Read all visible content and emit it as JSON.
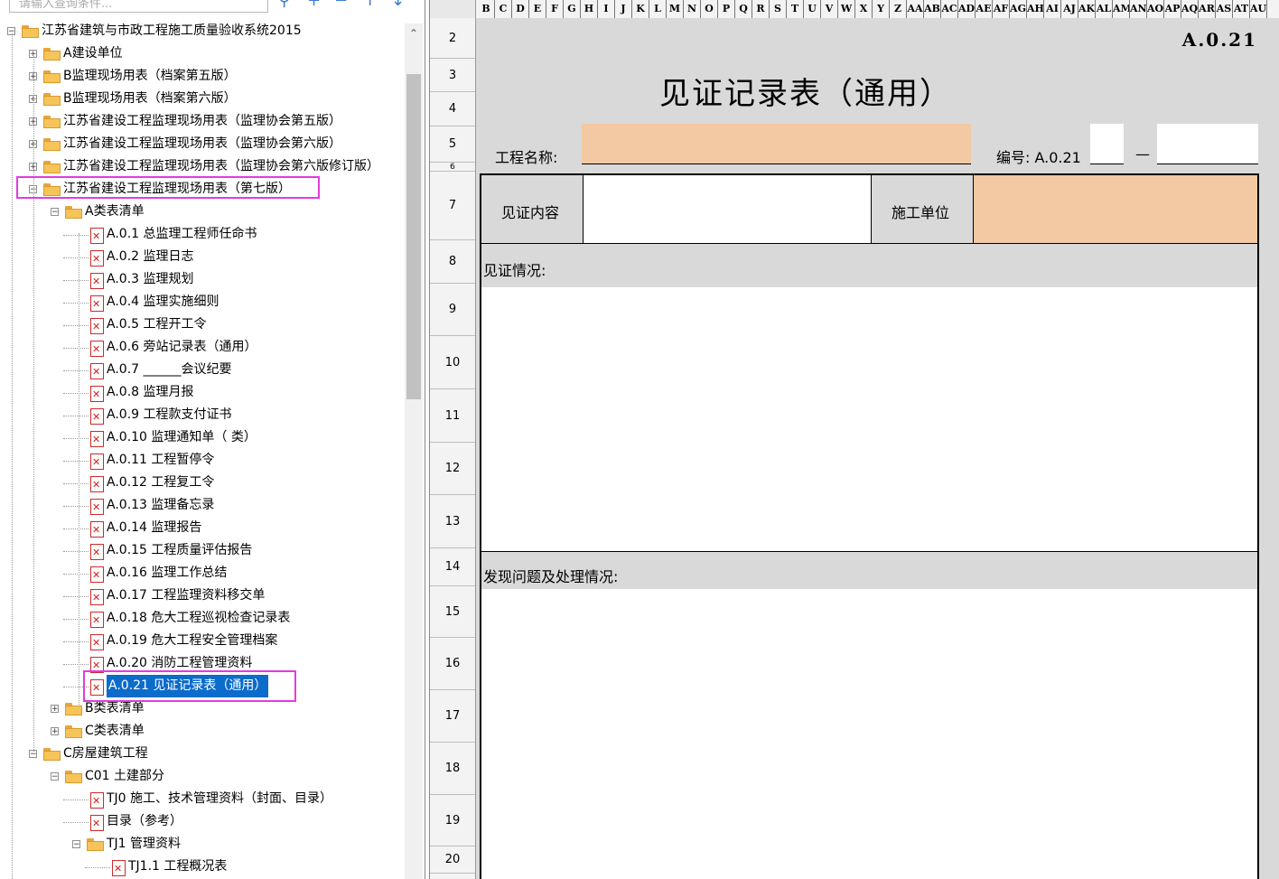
{
  "search": {
    "placeholder": "请输入查询条件..."
  },
  "toolbar": {
    "search_icon": "search-icon",
    "add_icon": "plus-icon",
    "remove_icon": "minus-icon",
    "up_icon": "arrow-up-icon",
    "down_icon": "arrow-down-icon"
  },
  "tree": {
    "root": "江苏省建筑与市政工程施工质量验收系统2015",
    "nodes": [
      "A建设单位",
      "B监理现场用表（档案第五版）",
      "B监理现场用表（档案第六版）",
      "江苏省建设工程监理现场用表（监理协会第五版）",
      "江苏省建设工程监理现场用表（监理协会第六版）",
      "江苏省建设工程监理现场用表（监理协会第六版修订版）",
      "江苏省建设工程监理现场用表（第七版）"
    ],
    "a_list": "A类表清单",
    "a_items": [
      "A.0.1  总监理工程师任命书",
      "A.0.2  监理日志",
      "A.0.3  监理规划",
      "A.0.4  监理实施细则",
      "A.0.5  工程开工令",
      "A.0.6  旁站记录表（通用）",
      "A.0.7  ______会议纪要",
      "A.0.8  监理月报",
      "A.0.9  工程款支付证书",
      "A.0.10  监理通知单（  类）",
      "A.0.11  工程暂停令",
      "A.0.12  工程复工令",
      "A.0.13  监理备忘录",
      "A.0.14  监理报告",
      "A.0.15  工程质量评估报告",
      "A.0.16  监理工作总结",
      "A.0.17  工程监理资料移交单",
      "A.0.18  危大工程巡视检查记录表",
      "A.0.19  危大工程安全管理档案",
      "A.0.20  消防工程管理资料",
      "A.0.21  见证记录表（通用）"
    ],
    "b_list": "B类表清单",
    "c_list": "C类表清单",
    "c_house": "C房屋建筑工程",
    "c01": "C01  土建部分",
    "tj0": "TJ0  施工、技术管理资料（封面、目录）",
    "mulu": "目录（参考）",
    "tj1": "TJ1  管理资料",
    "tj11": "TJ1.1  工程概况表"
  },
  "sheet": {
    "columns": [
      "B",
      "C",
      "D",
      "E",
      "F",
      "G",
      "H",
      "I",
      "J",
      "K",
      "L",
      "M",
      "N",
      "O",
      "P",
      "Q",
      "R",
      "S",
      "T",
      "U",
      "V",
      "W",
      "X",
      "Y",
      "Z",
      "AA",
      "AB",
      "AC",
      "AD",
      "AE",
      "AF",
      "AG",
      "AH",
      "AI",
      "AJ",
      "AK",
      "AL",
      "AM",
      "AN",
      "AO",
      "AP",
      "AQ",
      "AR",
      "AS",
      "AT",
      "AU"
    ],
    "rows": [
      "2",
      "3",
      "4",
      "5",
      "6",
      "7",
      "8",
      "9",
      "10",
      "11",
      "12",
      "13",
      "14",
      "15",
      "16",
      "17",
      "18",
      "19",
      "20"
    ],
    "code": "A.0.21",
    "title": "见证记录表（通用）",
    "project_name_label": "工程名称:",
    "number_label": "编号: A.0.21",
    "number_dash": "—",
    "witness_content_label": "见证内容",
    "contractor_label": "施工单位",
    "witness_status_label": "见证情况:",
    "issues_label": "发现问题及处理情况:"
  },
  "colors": {
    "input_fill": "#f2c9a2",
    "selection": "#0b6ccc",
    "highlight": "#e23be0",
    "sheet_bg": "#d9d9d9"
  }
}
